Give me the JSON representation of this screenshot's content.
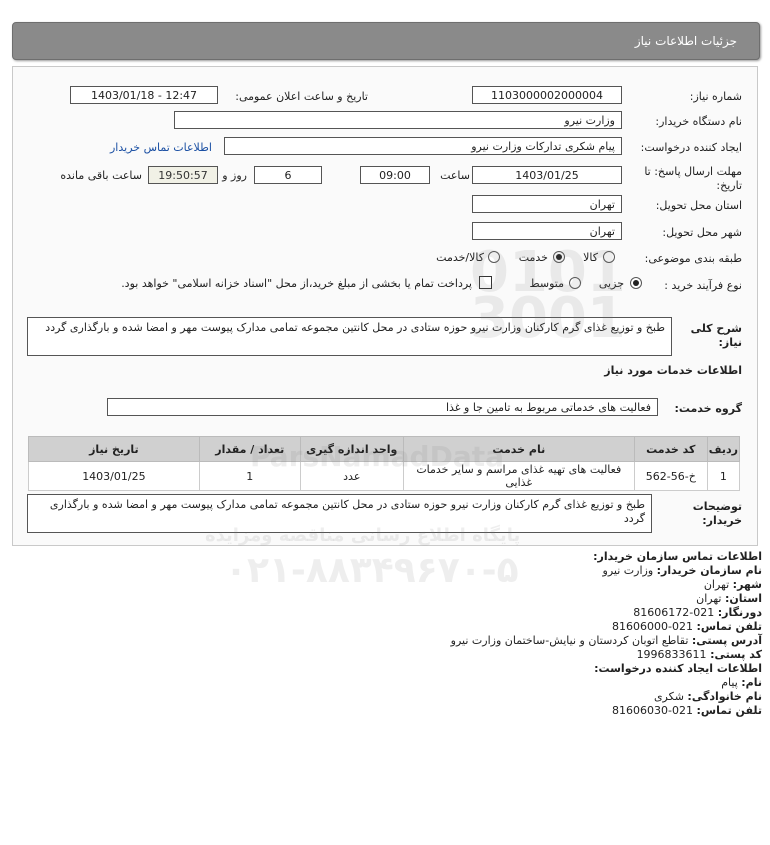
{
  "header": {
    "title": "جزئیات اطلاعات نیاز"
  },
  "fields": {
    "need_number_label": "شماره نیاز:",
    "need_number": "1103000002000004",
    "announce_label": "تاریخ و ساعت اعلان عمومی:",
    "announce_value": "1403/01/18 - 12:47",
    "buyer_org_label": "نام دستگاه خریدار:",
    "buyer_org": "وزارت نیرو",
    "creator_label": "ایجاد کننده درخواست:",
    "creator": "پیام شکری تدارکات وزارت نیرو",
    "buyer_contact_link": "اطلاعات تماس خریدار",
    "deadline_label": "مهلت ارسال پاسخ: تا تاریخ:",
    "deadline_date": "1403/01/25",
    "time_label": "ساعت",
    "deadline_time": "09:00",
    "days_value": "6",
    "days_label": "روز و",
    "remaining_time": "19:50:57",
    "remaining_label": "ساعت باقی مانده",
    "province_label": "استان محل تحویل:",
    "province": "تهران",
    "city_label": "شهر محل تحویل:",
    "city": "تهران",
    "category_label": "طبقه بندی موضوعی:",
    "category_options": [
      "کالا",
      "خدمت",
      "کالا/خدمت"
    ],
    "process_label": "نوع فرآیند خرید :",
    "process_options": [
      "جزیی",
      "متوسط"
    ],
    "treasury_note": "پرداخت تمام یا بخشی از مبلغ خرید،از محل \"اسناد خزانه اسلامی\" خواهد بود."
  },
  "summary": {
    "label": "شرح کلی نیاز:",
    "text": "طبخ و توزیع غذای گرم کارکنان وزارت نیرو حوزه ستادی در محل کانتین مجموعه تمامی مدارک پیوست مهر و امضا شده و بارگذاری گردد"
  },
  "services": {
    "section_title": "اطلاعات خدمات مورد نیاز",
    "group_label": "گروه خدمت:",
    "group_value": "فعالیت های خدماتی مربوط به تامین جا و غذا"
  },
  "table": {
    "headers": [
      "ردیف",
      "کد خدمت",
      "نام خدمت",
      "واحد اندازه گیری",
      "تعداد / مقدار",
      "تاریخ نیاز"
    ],
    "row": [
      "1",
      "خ-56-562",
      "فعالیت های تهیه غذای مراسم و سایر خدمات غذایی",
      "عدد",
      "1",
      "1403/01/25"
    ]
  },
  "buyer_notes": {
    "label": "توضیحات خریدار:",
    "text": "طبخ و توزیع غذای گرم کارکنان وزارت نیرو حوزه ستادی در محل کانتین مجموعه تمامی مدارک پیوست مهر و امضا شده و بارگذاری گردد"
  },
  "contact": {
    "title": "اطلاعات تماس سازمان خریدار:",
    "org_label": "نام سازمان خریدار:",
    "org": "وزارت نیرو",
    "city_label": "شهر:",
    "city": "تهران",
    "province_label": "استان:",
    "province": "تهران",
    "fax_label": "دورنگار:",
    "fax": "021-81606172",
    "phone_label": "تلفن تماس:",
    "phone": "021-81606000",
    "address_label": "آدرس پستی:",
    "address": "تقاطع اتوبان کردستان و نیایش-ساختمان وزارت نیرو",
    "postal_label": "کد پستی:",
    "postal": "1996833611",
    "creator_title": "اطلاعات ایجاد کننده درخواست:",
    "name_label": "نام:",
    "name": "پیام",
    "family_label": "نام خانوادگی:",
    "family": "شکری",
    "creator_phone_label": "تلفن تماس:",
    "creator_phone": "021-81606030"
  },
  "watermark": {
    "brand": "ParsNamadData",
    "tagline": "پایگاه اطلاع رسانی مناقصه ومزایده",
    "phone": "۰۲۱-۸۸۳۴۹۶۷۰-۵"
  }
}
